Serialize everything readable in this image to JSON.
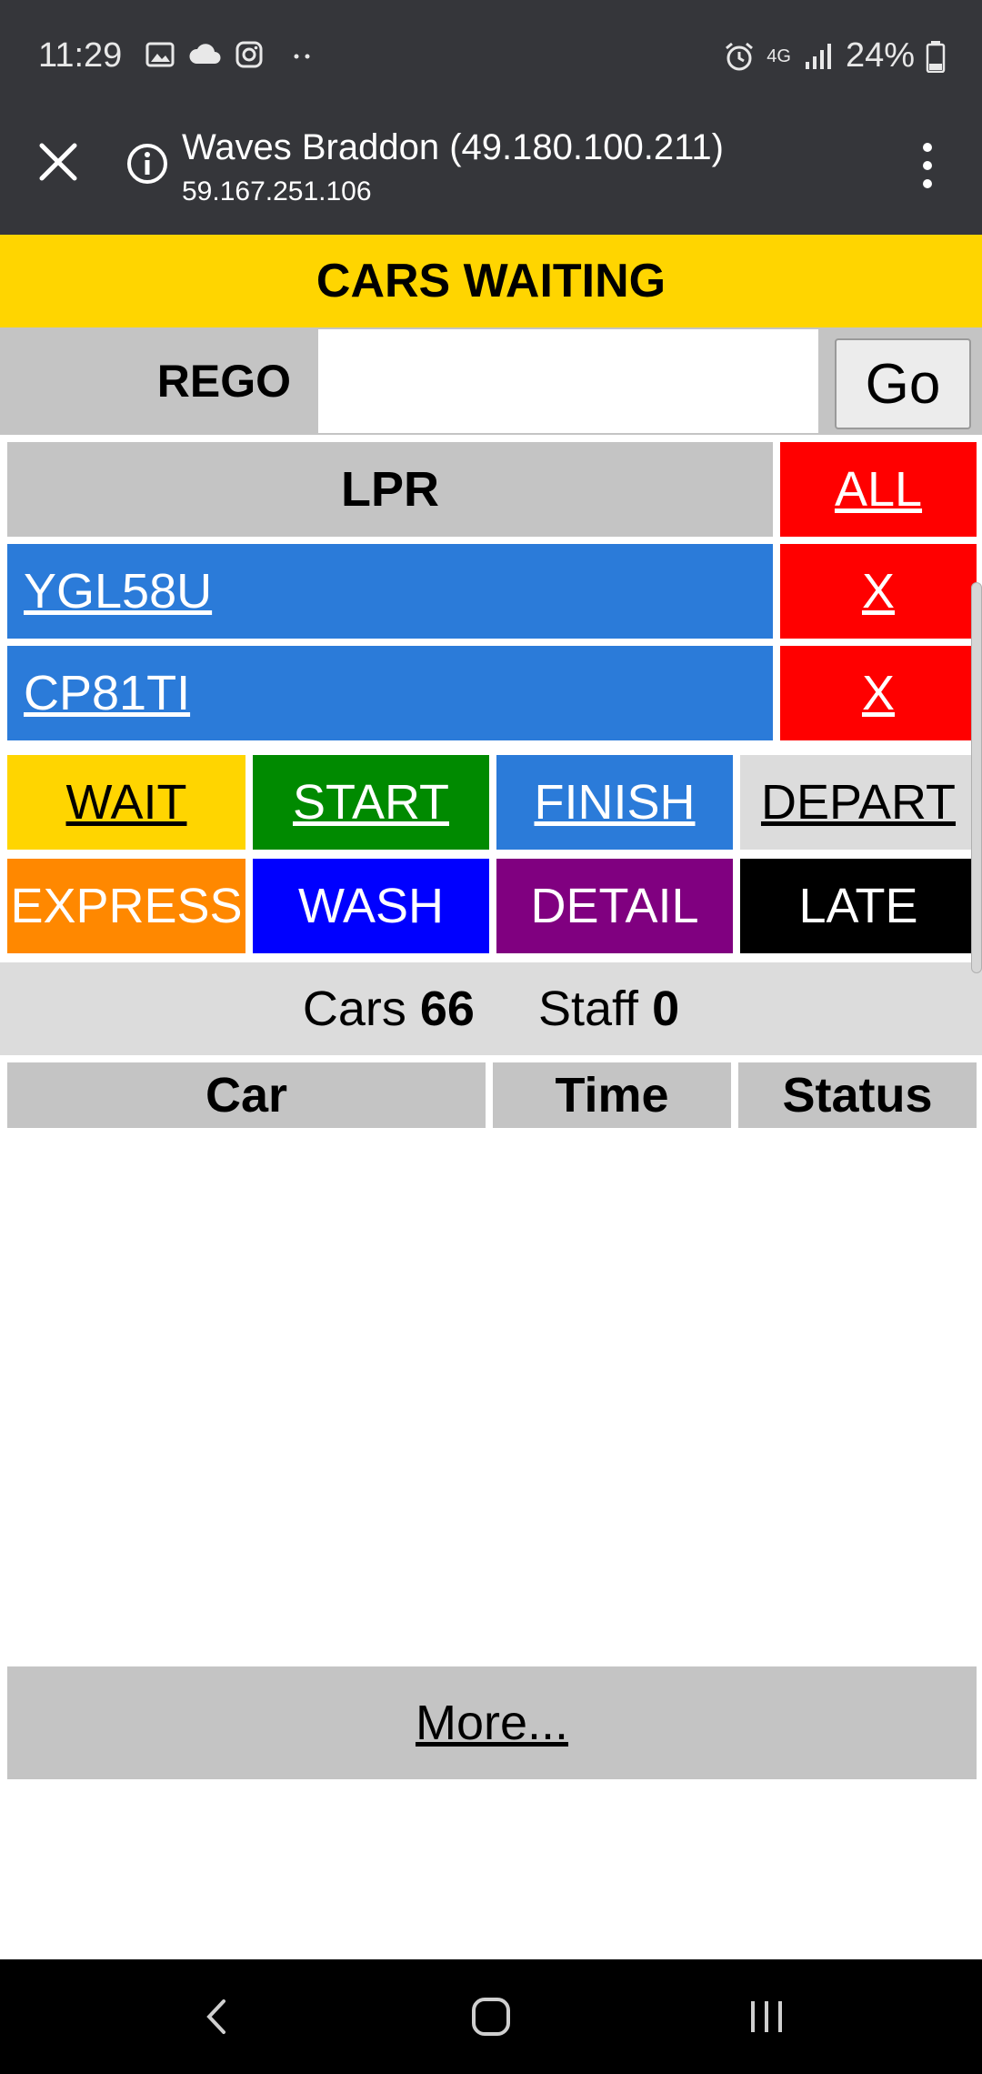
{
  "status_bar": {
    "time": "11:29",
    "network": "4G",
    "battery": "24%"
  },
  "browser": {
    "title": "Waves Braddon (49.180.100.211)",
    "url": "59.167.251.106"
  },
  "header": {
    "title": "CARS WAITING"
  },
  "rego": {
    "label": "REGO",
    "value": "",
    "go_label": "Go"
  },
  "lpr": {
    "header": "LPR",
    "all_label": "ALL",
    "plates": [
      {
        "plate": "YGL58U",
        "remove": "X"
      },
      {
        "plate": "CP81TI",
        "remove": "X"
      }
    ]
  },
  "status_buttons": {
    "wait": "WAIT",
    "start": "START",
    "finish": "FINISH",
    "depart": "DEPART",
    "express": "EXPRESS",
    "wash": "WASH",
    "detail": "DETAIL",
    "late": "LATE"
  },
  "summary": {
    "cars_label": "Cars",
    "cars_value": "66",
    "staff_label": "Staff",
    "staff_value": "0"
  },
  "results_table": {
    "col_car": "Car",
    "col_time": "Time",
    "col_status": "Status"
  },
  "more_label": "More...",
  "colors": {
    "header_yellow": "#ffd500",
    "plate_blue": "#2b7bd9",
    "red": "#ff0000",
    "green": "#008a00",
    "blue": "#0000ff",
    "purple": "#800080",
    "orange": "#ff8800"
  }
}
